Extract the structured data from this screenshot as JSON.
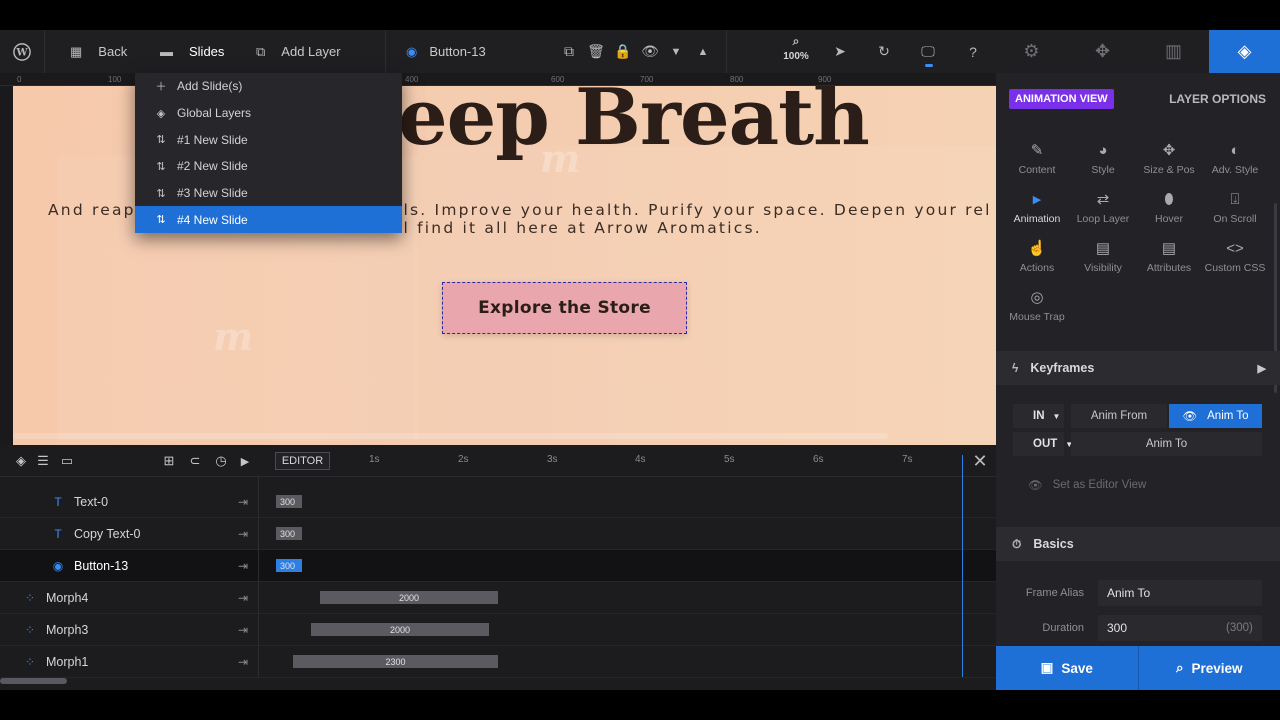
{
  "toolbar": {
    "back_label": "Back",
    "slides_label": "Slides",
    "add_layer_label": "Add Layer",
    "layer_name": "Button-13",
    "zoom": "100%"
  },
  "ruler": {
    "ticks": [
      "0",
      "100",
      "400",
      "600",
      "700",
      "800",
      "900"
    ]
  },
  "slides_menu": {
    "items": [
      {
        "label": "Add Slide(s)",
        "icon": "plus-icon"
      },
      {
        "label": "Global Layers",
        "icon": "layers-icon"
      },
      {
        "label": "#1 New Slide",
        "icon": "sort-icon"
      },
      {
        "label": "#2 New Slide",
        "icon": "sort-icon"
      },
      {
        "label": "#3 New Slide",
        "icon": "sort-icon"
      },
      {
        "label": "#4 New Slide",
        "icon": "sort-icon"
      }
    ],
    "active_index": 5
  },
  "canvas": {
    "headline": "eep Breath",
    "subline_1_left": "And reap",
    "subline_1_right": "ils. Improve your health. Purify your space. Deepen your rel",
    "subline_2": "ll find it all here at Arrow Aromatics.",
    "cta": "Explore the Store"
  },
  "timeline": {
    "editor_label": "EDITOR",
    "seconds": [
      "1s",
      "2s",
      "3s",
      "4s",
      "5s",
      "6s",
      "7s"
    ],
    "rows": [
      {
        "name": "Text-0",
        "bar": "300"
      },
      {
        "name": "Copy Text-0",
        "bar": "300"
      },
      {
        "name": "Button-13",
        "bar": "300"
      },
      {
        "name": "Morph4",
        "bar": "2000"
      },
      {
        "name": "Morph3",
        "bar": "2000"
      },
      {
        "name": "Morph1",
        "bar": "2300"
      }
    ]
  },
  "panel": {
    "animation_view": "ANIMATION VIEW",
    "layer_options": "LAYER OPTIONS",
    "options": [
      {
        "label": "Content",
        "icon": "pencil-icon"
      },
      {
        "label": "Style",
        "icon": "palette-icon"
      },
      {
        "label": "Size & Pos",
        "icon": "move-icon"
      },
      {
        "label": "Adv. Style",
        "icon": "contrast-icon"
      },
      {
        "label": "Animation",
        "icon": "play-icon"
      },
      {
        "label": "Loop Layer",
        "icon": "loop-icon"
      },
      {
        "label": "Hover",
        "icon": "mouse-icon"
      },
      {
        "label": "On Scroll",
        "icon": "scroll-icon"
      },
      {
        "label": "Actions",
        "icon": "hand-icon"
      },
      {
        "label": "Visibility",
        "icon": "visibility-icon"
      },
      {
        "label": "Attributes",
        "icon": "file-icon"
      },
      {
        "label": "Custom CSS",
        "icon": "code-icon"
      },
      {
        "label": "Mouse Trap",
        "icon": "target-icon"
      }
    ],
    "keyframes": {
      "title": "Keyframes",
      "in_label": "IN",
      "out_label": "OUT",
      "anim_from": "Anim From",
      "anim_to": "Anim To",
      "out_anim_to": "Anim To",
      "set_editor": "Set as Editor View"
    },
    "basics": {
      "title": "Basics",
      "frame_alias_label": "Frame Alias",
      "frame_alias_value": "Anim To",
      "duration_label": "Duration",
      "duration_value": "300",
      "duration_hint": "(300)"
    },
    "save_label": "Save",
    "preview_label": "Preview"
  },
  "colors": {
    "accent": "#1e6fd6",
    "animation_badge": "#7a2fe8",
    "canvas_bg": "#f4ccb0",
    "cta_bg": "#e9a6ad"
  }
}
